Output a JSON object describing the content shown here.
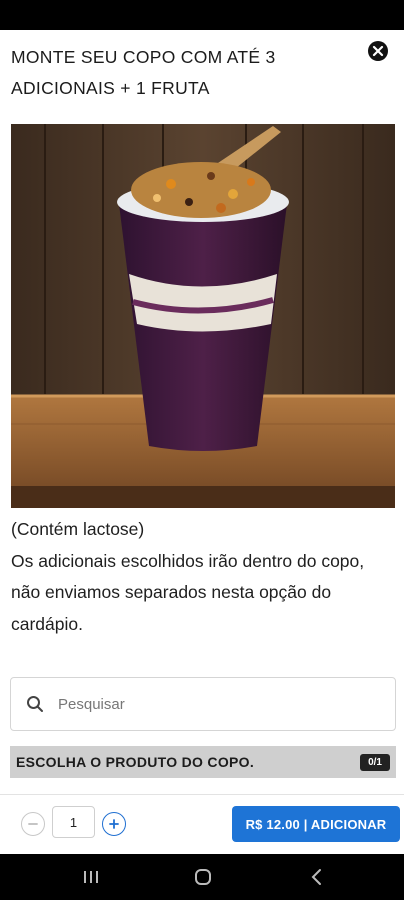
{
  "header": {
    "title": "MONTE SEU COPO COM ATÉ 3 ADICIONAIS + 1 FRUTA"
  },
  "product": {
    "description_lines": [
      "(Contém lactose)",
      "Os adicionais escolhidos irão dentro do copo,",
      "não enviamos separados nesta opção do cardápio."
    ]
  },
  "search": {
    "placeholder": "Pesquisar",
    "value": ""
  },
  "section": {
    "title": "ESCOLHA O PRODUTO DO COPO.",
    "badge": "0/1"
  },
  "footer": {
    "quantity": "1",
    "add_label": "R$ 12.00 | ADICIONAR"
  },
  "icons": {
    "close": "close-icon",
    "search": "search-icon",
    "minus": "minus-icon",
    "plus": "plus-icon",
    "nav_recents": "recents-icon",
    "nav_home": "home-icon",
    "nav_back": "back-icon"
  },
  "colors": {
    "accent": "#1e74d6",
    "section_bg": "#cfcfcf",
    "badge_bg": "#222222"
  }
}
